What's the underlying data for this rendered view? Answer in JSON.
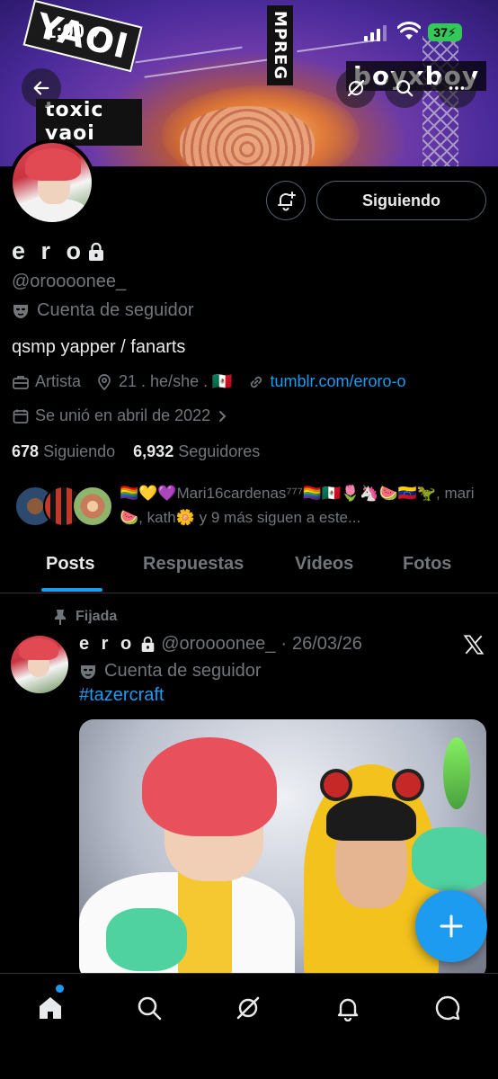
{
  "status_bar": {
    "time": "1:00",
    "battery": "37"
  },
  "banner": {
    "sticker_1": "YAOI",
    "sticker_2": "toxic yaoi",
    "sticker_3": "MPREG",
    "sticker_4": "boyxboy"
  },
  "profile": {
    "name": "e r o",
    "handle": "@oroooonee_",
    "account_type": "Cuenta de seguidor",
    "bio": "qsmp yapper / fanarts",
    "profession": "Artista",
    "location": "21 . he/she . 🇲🇽",
    "website": "tumblr.com/eroro-o",
    "joined": "Se unió en abril de 2022",
    "following_count": "678",
    "following_label": "Siguiendo",
    "followers_count": "6,932",
    "followers_label": "Seguidores",
    "follow_button": "Siguiendo",
    "followed_by": "🏳️‍🌈💛💜Mari16cardenas⁷⁷⁷🏳️‍🌈🇲🇽🌷🦄🍉🇻🇪🦖, mari 🍉, kath🌼 y 9 más siguen a este..."
  },
  "tabs": [
    {
      "label": "Posts",
      "active": true
    },
    {
      "label": "Respuestas",
      "active": false
    },
    {
      "label": "Videos",
      "active": false
    },
    {
      "label": "Fotos",
      "active": false
    }
  ],
  "post": {
    "pinned_label": "Fijada",
    "name": "e r o",
    "handle": "@oroooonee_",
    "separator": "·",
    "date": "26/03/26",
    "account_type": "Cuenta de seguidor",
    "hashtag": "#tazercraft"
  },
  "colors": {
    "accent": "#1d9bf0",
    "muted": "#71767b",
    "text": "#e7e9ea",
    "border": "#2f3336"
  },
  "icons": [
    "back-arrow-icon",
    "grok-icon",
    "search-icon",
    "more-icon",
    "lock-icon",
    "mask-icon",
    "briefcase-icon",
    "location-pin-icon",
    "link-icon",
    "calendar-icon",
    "chevron-right-icon",
    "bell-plus-icon",
    "pin-icon",
    "x-logo-icon",
    "plus-icon",
    "home-icon",
    "grok-nav-icon",
    "bell-icon",
    "chat-icon"
  ]
}
